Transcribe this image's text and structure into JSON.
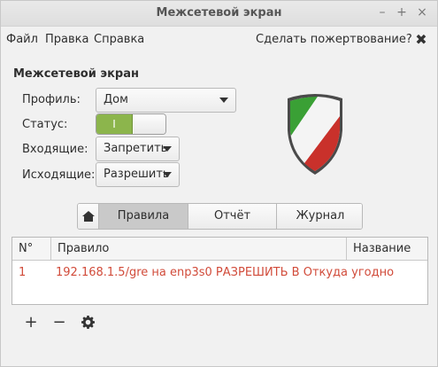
{
  "window": {
    "title": "Межсетевой экран",
    "minimize": "–",
    "maximize": "+",
    "close": "×"
  },
  "menu": {
    "file": "Файл",
    "edit": "Правка",
    "help": "Справка",
    "donate": "Сделать пожертвование?",
    "close": "✖"
  },
  "section_title": "Межсетевой экран",
  "profile": {
    "label": "Профиль:",
    "value": "Дом"
  },
  "status": {
    "label": "Статус:",
    "on_text": "I",
    "enabled": true
  },
  "incoming": {
    "label": "Входящие:",
    "value": "Запретить"
  },
  "outgoing": {
    "label": "Исходящие:",
    "value": "Разрешить"
  },
  "tabs": {
    "home_icon": "home-icon",
    "rules": "Правила",
    "report": "Отчёт",
    "log": "Журнал",
    "active": "rules"
  },
  "table": {
    "headers": {
      "num": "N°",
      "rule": "Правило",
      "name": "Название"
    },
    "rows": [
      {
        "num": "1",
        "rule": "192.168.1.5/gre на enp3s0 РАЗРЕШИТЬ В Откуда угодно",
        "name": ""
      }
    ]
  },
  "toolbar": {
    "add": "+",
    "remove": "−",
    "settings_icon": "gear-icon"
  },
  "colors": {
    "switch_on": "#8cb54c",
    "rule_text": "#d14b3a",
    "shield_green": "#3aa035",
    "shield_red": "#c9312b"
  }
}
